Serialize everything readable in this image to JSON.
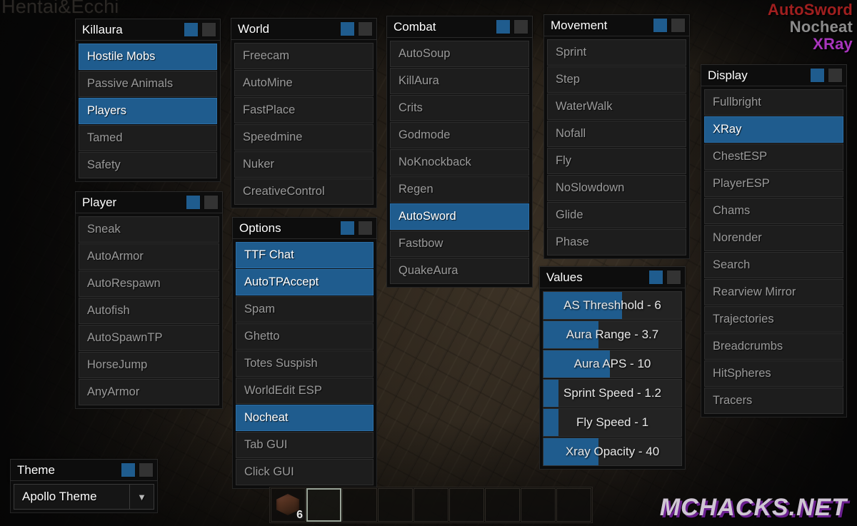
{
  "hud": {
    "watermark_topleft": "Hentai&Ecchi",
    "watermark_bottomright": "MCHACKS.NET",
    "arraylist": [
      {
        "label": "AutoSword",
        "color": "#a01f1f"
      },
      {
        "label": "Nocheat",
        "color": "#8c8c8c"
      },
      {
        "label": "XRay",
        "color": "#a935bd"
      }
    ]
  },
  "colors": {
    "accent_blue": "#1f5c8e",
    "panel_bg": "#0c0c0c",
    "row_bg": "#1d1d1d",
    "row_text": "#9a9a9a",
    "row_text_on": "#ffffff"
  },
  "panels": [
    {
      "name": "killaura",
      "title": "Killaura",
      "toggle_left": "on",
      "toggle_right": "off",
      "items": [
        {
          "label": "Hostile Mobs",
          "enabled": true
        },
        {
          "label": "Passive Animals",
          "enabled": false
        },
        {
          "label": "Players",
          "enabled": true
        },
        {
          "label": "Tamed",
          "enabled": false
        },
        {
          "label": "Safety",
          "enabled": false
        }
      ]
    },
    {
      "name": "player",
      "title": "Player",
      "toggle_left": "on",
      "toggle_right": "off",
      "items": [
        {
          "label": "Sneak",
          "enabled": false
        },
        {
          "label": "AutoArmor",
          "enabled": false
        },
        {
          "label": "AutoRespawn",
          "enabled": false
        },
        {
          "label": "Autofish",
          "enabled": false
        },
        {
          "label": "AutoSpawnTP",
          "enabled": false
        },
        {
          "label": "HorseJump",
          "enabled": false
        },
        {
          "label": "AnyArmor",
          "enabled": false
        }
      ]
    },
    {
      "name": "world",
      "title": "World",
      "toggle_left": "on",
      "toggle_right": "off",
      "items": [
        {
          "label": "Freecam",
          "enabled": false
        },
        {
          "label": "AutoMine",
          "enabled": false
        },
        {
          "label": "FastPlace",
          "enabled": false
        },
        {
          "label": "Speedmine",
          "enabled": false
        },
        {
          "label": "Nuker",
          "enabled": false
        },
        {
          "label": "CreativeControl",
          "enabled": false
        }
      ]
    },
    {
      "name": "options",
      "title": "Options",
      "toggle_left": "on",
      "toggle_right": "off",
      "items": [
        {
          "label": "TTF Chat",
          "enabled": true
        },
        {
          "label": "AutoTPAccept",
          "enabled": true
        },
        {
          "label": "Spam",
          "enabled": false
        },
        {
          "label": "Ghetto",
          "enabled": false
        },
        {
          "label": "Totes Suspish",
          "enabled": false
        },
        {
          "label": "WorldEdit ESP",
          "enabled": false
        },
        {
          "label": "Nocheat",
          "enabled": true
        },
        {
          "label": "Tab GUI",
          "enabled": false
        },
        {
          "label": "Click GUI",
          "enabled": false
        }
      ]
    },
    {
      "name": "combat",
      "title": "Combat",
      "toggle_left": "on",
      "toggle_right": "off",
      "items": [
        {
          "label": "AutoSoup",
          "enabled": false
        },
        {
          "label": "KillAura",
          "enabled": false
        },
        {
          "label": "Crits",
          "enabled": false
        },
        {
          "label": "Godmode",
          "enabled": false
        },
        {
          "label": "NoKnockback",
          "enabled": false
        },
        {
          "label": "Regen",
          "enabled": false
        },
        {
          "label": "AutoSword",
          "enabled": true
        },
        {
          "label": "Fastbow",
          "enabled": false
        },
        {
          "label": "QuakeAura",
          "enabled": false
        }
      ]
    },
    {
      "name": "movement",
      "title": "Movement",
      "toggle_left": "on",
      "toggle_right": "off",
      "items": [
        {
          "label": "Sprint",
          "enabled": false
        },
        {
          "label": "Step",
          "enabled": false
        },
        {
          "label": "WaterWalk",
          "enabled": false
        },
        {
          "label": "Nofall",
          "enabled": false
        },
        {
          "label": "Fly",
          "enabled": false
        },
        {
          "label": "NoSlowdown",
          "enabled": false
        },
        {
          "label": "Glide",
          "enabled": false
        },
        {
          "label": "Phase",
          "enabled": false
        }
      ]
    },
    {
      "name": "display",
      "title": "Display",
      "toggle_left": "on",
      "toggle_right": "off",
      "items": [
        {
          "label": "Fullbright",
          "enabled": false
        },
        {
          "label": "XRay",
          "enabled": true
        },
        {
          "label": "ChestESP",
          "enabled": false
        },
        {
          "label": "PlayerESP",
          "enabled": false
        },
        {
          "label": "Chams",
          "enabled": false
        },
        {
          "label": "Norender",
          "enabled": false
        },
        {
          "label": "Search",
          "enabled": false
        },
        {
          "label": "Rearview Mirror",
          "enabled": false
        },
        {
          "label": "Trajectories",
          "enabled": false
        },
        {
          "label": "Breadcrumbs",
          "enabled": false
        },
        {
          "label": "HitSpheres",
          "enabled": false
        },
        {
          "label": "Tracers",
          "enabled": false
        }
      ]
    }
  ],
  "values_panel": {
    "title": "Values",
    "toggle_left": "on",
    "toggle_right": "off",
    "sliders": [
      {
        "name": "as-threshhold",
        "label": "AS Threshhold - 6",
        "value": 6,
        "fill_percent": 57
      },
      {
        "name": "aura-range",
        "label": "Aura Range - 3.7",
        "value": 3.7,
        "fill_percent": 40
      },
      {
        "name": "aura-aps",
        "label": "Aura APS - 10",
        "value": 10,
        "fill_percent": 48
      },
      {
        "name": "sprint-speed",
        "label": "Sprint Speed - 1.2",
        "value": 1.2,
        "fill_percent": 11
      },
      {
        "name": "fly-speed",
        "label": "Fly Speed - 1",
        "value": 1,
        "fill_percent": 11
      },
      {
        "name": "xray-opacity",
        "label": "Xray Opacity - 40",
        "value": 40,
        "fill_percent": 40
      }
    ]
  },
  "theme_panel": {
    "title": "Theme",
    "toggle_left": "on",
    "toggle_right": "off",
    "selected": "Apollo Theme",
    "arrow": "▼"
  },
  "hotbar": {
    "slots": [
      {
        "index": 1,
        "item": "redstone-block",
        "count": "6",
        "selected": false
      },
      {
        "index": 2,
        "item": "",
        "count": "",
        "selected": true
      },
      {
        "index": 3,
        "item": "",
        "count": "",
        "selected": false
      },
      {
        "index": 4,
        "item": "",
        "count": "",
        "selected": false
      },
      {
        "index": 5,
        "item": "",
        "count": "",
        "selected": false
      },
      {
        "index": 6,
        "item": "",
        "count": "",
        "selected": false
      },
      {
        "index": 7,
        "item": "",
        "count": "",
        "selected": false
      },
      {
        "index": 8,
        "item": "",
        "count": "",
        "selected": false
      },
      {
        "index": 9,
        "item": "",
        "count": "",
        "selected": false
      }
    ]
  }
}
